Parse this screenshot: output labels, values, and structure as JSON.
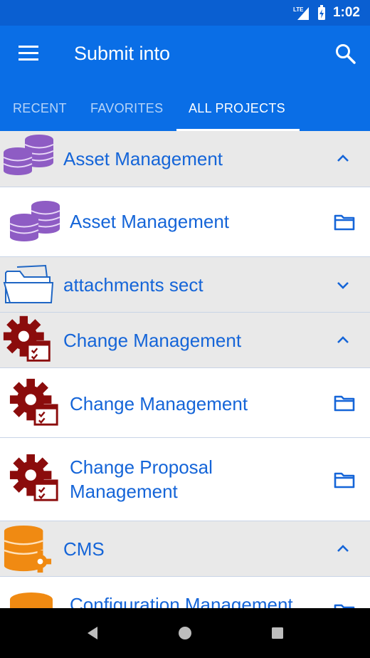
{
  "status_bar": {
    "network": "LTE",
    "time": "1:02"
  },
  "app_bar": {
    "title": "Submit into",
    "menu_icon": "hamburger-menu-icon",
    "search_icon": "search-icon"
  },
  "tabs": [
    {
      "label": "RECENT",
      "active": false
    },
    {
      "label": "FAVORITES",
      "active": false
    },
    {
      "label": "ALL PROJECTS",
      "active": true
    }
  ],
  "list": [
    {
      "kind": "group",
      "label": "Asset Management",
      "icon": "database-purple-icon",
      "state": "expanded"
    },
    {
      "kind": "item",
      "label": "Asset Management",
      "icon": "database-purple-icon",
      "action_icon": "folder-icon"
    },
    {
      "kind": "group",
      "label": "attachments sect",
      "icon": "folder-outline-icon",
      "state": "collapsed"
    },
    {
      "kind": "group",
      "label": "Change Management",
      "icon": "gear-checklist-red-icon",
      "state": "expanded"
    },
    {
      "kind": "item",
      "label": "Change Management",
      "icon": "gear-checklist-red-icon",
      "action_icon": "folder-icon"
    },
    {
      "kind": "item",
      "label_lines": [
        "Change Proposal",
        "Management"
      ],
      "icon": "gear-checklist-red-icon",
      "action_icon": "folder-icon"
    },
    {
      "kind": "group",
      "label": "CMS",
      "icon": "database-gear-orange-icon",
      "state": "expanded"
    },
    {
      "kind": "item",
      "label": "Configuration Management",
      "icon": "database-orange-icon",
      "action_icon": "folder-icon"
    }
  ],
  "colors": {
    "status_bar": "#0a5fd1",
    "app_bar": "#0a6ee6",
    "link_text": "#1565d8",
    "group_bg": "#e9e9e9",
    "purple": "#8e5cc4",
    "dark_red": "#8b0c0c",
    "orange": "#f08a12"
  },
  "nav_bar": {
    "back_icon": "back-triangle-icon",
    "home_icon": "home-circle-icon",
    "recents_icon": "recents-square-icon"
  }
}
